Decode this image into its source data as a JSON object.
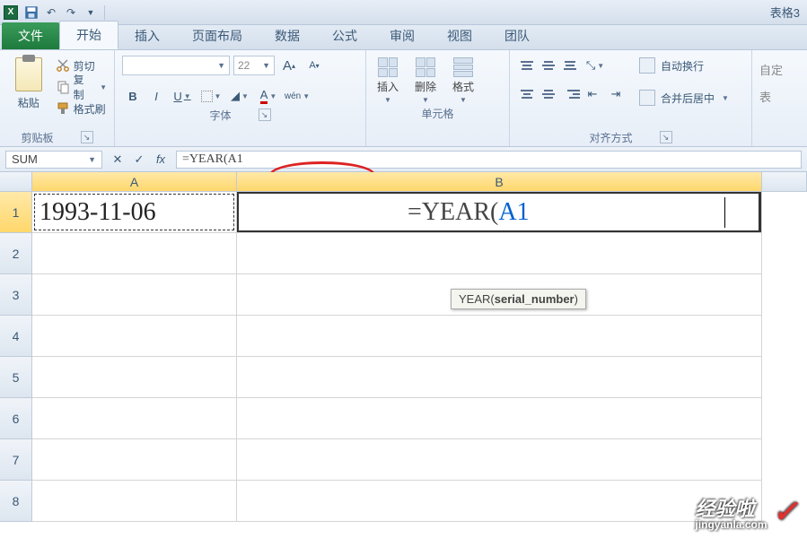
{
  "title_right": "表格3",
  "tabs": {
    "file": "文件",
    "home": "开始",
    "insert": "插入",
    "layout": "页面布局",
    "data": "数据",
    "formula": "公式",
    "review": "审阅",
    "view": "视图",
    "team": "团队"
  },
  "clipboard": {
    "paste": "粘贴",
    "cut": "剪切",
    "copy": "复制",
    "painter": "格式刷",
    "group": "剪贴板"
  },
  "font": {
    "size": "22",
    "bold": "B",
    "italic": "I",
    "underline": "U",
    "a_big": "A",
    "a_small": "A",
    "wen": "wén",
    "group": "字体"
  },
  "cells": {
    "insert": "插入",
    "delete": "删除",
    "format": "格式",
    "group": "单元格"
  },
  "align": {
    "wrap": "自动换行",
    "merge": "合并后居中",
    "group": "对齐方式"
  },
  "auto": {
    "line1": "自定",
    "line2": "表"
  },
  "fbar": {
    "name": "SUM",
    "cancel": "✕",
    "enter": "✓",
    "fx": "fx",
    "formula": "=YEAR(A1"
  },
  "columns": [
    "A",
    "B"
  ],
  "row_numbers": [
    "1",
    "2",
    "3",
    "4",
    "5",
    "6",
    "7",
    "8"
  ],
  "a1_value": "1993-11-06",
  "b1_prefix": "=YEAR(",
  "b1_ref": "A1",
  "tooltip": {
    "fn": "YEAR(",
    "arg": "serial_number",
    "end": ")"
  },
  "watermark": {
    "top": "经验啦",
    "bottom": "jingyanla.com",
    "check": "✓"
  }
}
